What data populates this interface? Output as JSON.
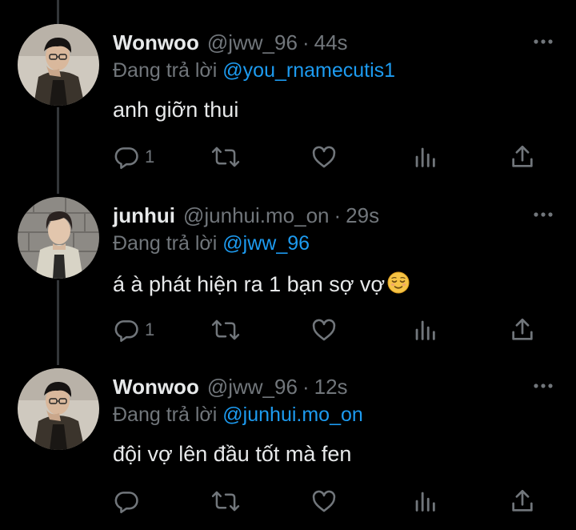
{
  "tweets": [
    {
      "name": "Wonwoo",
      "handle": "@jww_96",
      "separator": "·",
      "time": "44s",
      "replying_prefix": "Đang trả lời",
      "replying_to": "@you_rnamecutis1",
      "text": "anh giỡn thui",
      "emoji": "",
      "reply_count": "1"
    },
    {
      "name": "junhui",
      "handle": "@junhui.mo_on",
      "separator": "·",
      "time": "29s",
      "replying_prefix": "Đang trả lời",
      "replying_to": "@jww_96",
      "text": "á à phát hiện ra 1 bạn sợ vợ",
      "emoji": "😌",
      "reply_count": "1"
    },
    {
      "name": "Wonwoo",
      "handle": "@jww_96",
      "separator": "·",
      "time": "12s",
      "replying_prefix": "Đang trả lời",
      "replying_to": "@junhui.mo_on",
      "text": "đội vợ lên đầu tốt mà fen",
      "emoji": "",
      "reply_count": ""
    }
  ],
  "colors": {
    "background": "#000000",
    "primary_text": "#e7e9ea",
    "secondary_text": "#71767b",
    "mention": "#1d9bf0",
    "thread_line": "#333639"
  },
  "icons": {
    "reply": "reply-icon",
    "retweet": "retweet-icon",
    "like": "heart-icon",
    "views": "views-icon",
    "share": "share-icon",
    "more": "more-icon"
  }
}
